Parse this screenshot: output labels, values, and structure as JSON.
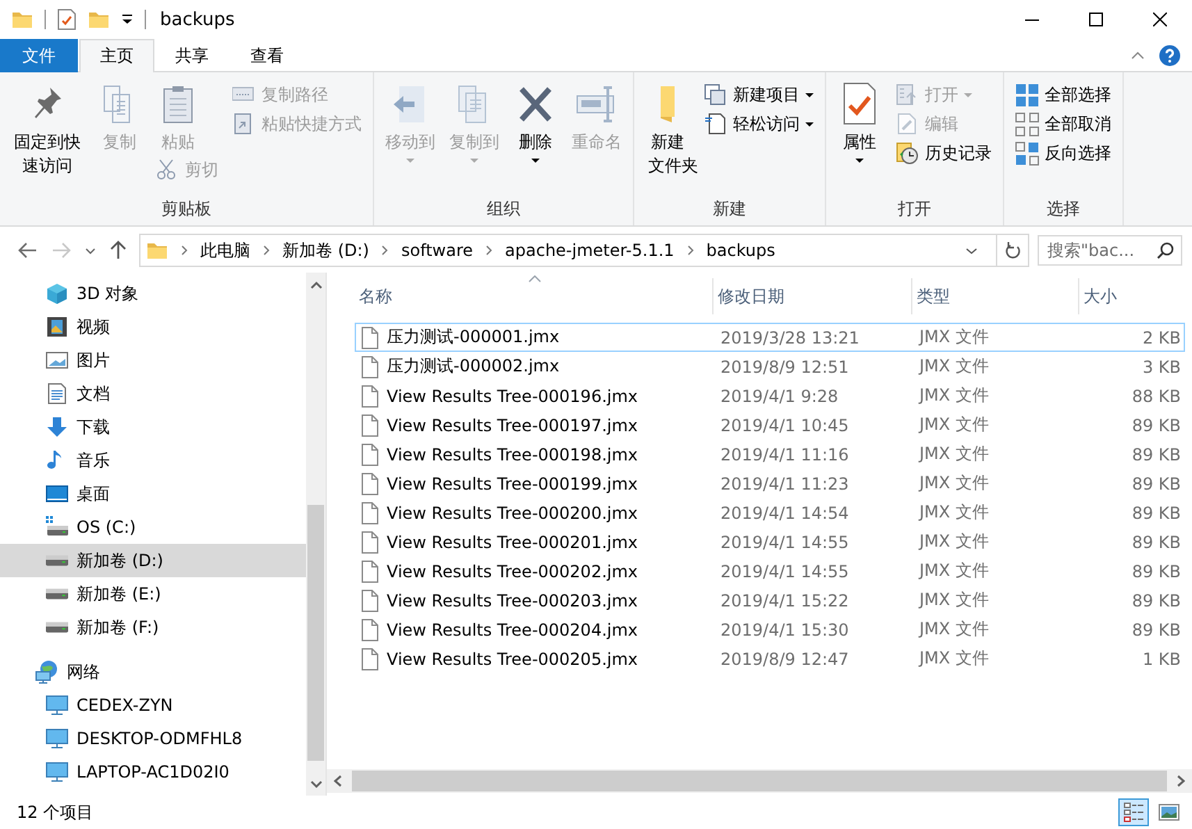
{
  "window": {
    "title": "backups"
  },
  "tabs": [
    {
      "label": "文件",
      "kind": "file",
      "selected": false
    },
    {
      "label": "主页",
      "kind": "normal",
      "selected": true
    },
    {
      "label": "共享",
      "kind": "normal",
      "selected": false
    },
    {
      "label": "查看",
      "kind": "normal",
      "selected": false
    }
  ],
  "ribbon": {
    "groups": [
      {
        "label": "剪贴板",
        "columns": [
          {
            "items": [
              {
                "label": "固定到快速访问",
                "kind": "large",
                "disabled": false,
                "dropdown": false
              }
            ]
          },
          {
            "items": [
              {
                "label": "复制",
                "kind": "large",
                "disabled": true,
                "dropdown": false
              }
            ]
          },
          {
            "items": [
              {
                "label": "粘贴",
                "kind": "large",
                "disabled": true,
                "dropdown": false
              },
              {
                "label": "剪切",
                "kind": "small",
                "disabled": true,
                "dropdown": false
              }
            ]
          },
          {
            "items": [
              {
                "label": "复制路径",
                "kind": "small",
                "disabled": true,
                "dropdown": false
              },
              {
                "label": "粘贴快捷方式",
                "kind": "small",
                "disabled": true,
                "dropdown": false
              }
            ]
          }
        ]
      },
      {
        "label": "组织",
        "columns": [
          {
            "items": [
              {
                "label": "移动到",
                "kind": "large",
                "disabled": true,
                "dropdown": true
              }
            ]
          },
          {
            "items": [
              {
                "label": "复制到",
                "kind": "large",
                "disabled": true,
                "dropdown": true
              }
            ]
          },
          {
            "items": [
              {
                "label": "删除",
                "kind": "large",
                "disabled": false,
                "dropdown": true
              }
            ]
          },
          {
            "items": [
              {
                "label": "重命名",
                "kind": "large",
                "disabled": true,
                "dropdown": false
              }
            ]
          }
        ]
      },
      {
        "label": "新建",
        "columns": [
          {
            "items": [
              {
                "label": "新建文件夹",
                "kind": "large",
                "disabled": false,
                "dropdown": false
              }
            ]
          },
          {
            "items": [
              {
                "label": "新建项目",
                "kind": "small",
                "disabled": false,
                "dropdown": true
              },
              {
                "label": "轻松访问",
                "kind": "small",
                "disabled": false,
                "dropdown": true
              }
            ]
          }
        ]
      },
      {
        "label": "打开",
        "columns": [
          {
            "items": [
              {
                "label": "属性",
                "kind": "large",
                "disabled": false,
                "dropdown": true
              }
            ]
          },
          {
            "items": [
              {
                "label": "打开",
                "kind": "small",
                "disabled": true,
                "dropdown": true
              },
              {
                "label": "编辑",
                "kind": "small",
                "disabled": true,
                "dropdown": false
              },
              {
                "label": "历史记录",
                "kind": "small",
                "disabled": false,
                "dropdown": false
              }
            ]
          }
        ]
      },
      {
        "label": "选择",
        "columns": [
          {
            "items": [
              {
                "label": "全部选择",
                "kind": "small",
                "disabled": false,
                "dropdown": false
              },
              {
                "label": "全部取消",
                "kind": "small",
                "disabled": false,
                "dropdown": false
              },
              {
                "label": "反向选择",
                "kind": "small",
                "disabled": false,
                "dropdown": false
              }
            ]
          }
        ]
      }
    ]
  },
  "address": {
    "back": {
      "disabled": false
    },
    "forward": {
      "disabled": true
    },
    "breadcrumbs": [
      "此电脑",
      "新加卷 (D:)",
      "software",
      "apache-jmeter-5.1.1",
      "backups"
    ],
    "search": {
      "placeholder": "搜索\"bac..."
    }
  },
  "nav": {
    "items": [
      {
        "label": "3D 对象",
        "selected": false
      },
      {
        "label": "视频",
        "selected": false
      },
      {
        "label": "图片",
        "selected": false
      },
      {
        "label": "文档",
        "selected": false
      },
      {
        "label": "下载",
        "selected": false
      },
      {
        "label": "音乐",
        "selected": false
      },
      {
        "label": "桌面",
        "selected": false
      },
      {
        "label": "OS (C:)",
        "selected": false
      },
      {
        "label": "新加卷 (D:)",
        "selected": true
      },
      {
        "label": "新加卷 (E:)",
        "selected": false
      },
      {
        "label": "新加卷 (F:)",
        "selected": false
      },
      {
        "label": "网络",
        "selected": false,
        "children": [
          {
            "label": "CEDEX-ZYN",
            "selected": false
          },
          {
            "label": "DESKTOP-ODMFHL8",
            "selected": false
          },
          {
            "label": "LAPTOP-AC1D02I0",
            "selected": false
          }
        ]
      }
    ]
  },
  "files": {
    "columns": [
      {
        "label": "名称",
        "sorted": true
      },
      {
        "label": "修改日期",
        "sorted": false
      },
      {
        "label": "类型",
        "sorted": false
      },
      {
        "label": "大小",
        "sorted": false
      }
    ],
    "rows": [
      {
        "name": "压力测试-000001.jmx",
        "modified": "2019/3/28 13:21",
        "type": "JMX 文件",
        "size": "2 KB",
        "focused": true
      },
      {
        "name": "压力测试-000002.jmx",
        "modified": "2019/8/9 12:51",
        "type": "JMX 文件",
        "size": "3 KB",
        "focused": false
      },
      {
        "name": "View Results Tree-000196.jmx",
        "modified": "2019/4/1 9:28",
        "type": "JMX 文件",
        "size": "88 KB",
        "focused": false
      },
      {
        "name": "View Results Tree-000197.jmx",
        "modified": "2019/4/1 10:45",
        "type": "JMX 文件",
        "size": "89 KB",
        "focused": false
      },
      {
        "name": "View Results Tree-000198.jmx",
        "modified": "2019/4/1 11:16",
        "type": "JMX 文件",
        "size": "89 KB",
        "focused": false
      },
      {
        "name": "View Results Tree-000199.jmx",
        "modified": "2019/4/1 11:23",
        "type": "JMX 文件",
        "size": "89 KB",
        "focused": false
      },
      {
        "name": "View Results Tree-000200.jmx",
        "modified": "2019/4/1 14:54",
        "type": "JMX 文件",
        "size": "89 KB",
        "focused": false
      },
      {
        "name": "View Results Tree-000201.jmx",
        "modified": "2019/4/1 14:55",
        "type": "JMX 文件",
        "size": "89 KB",
        "focused": false
      },
      {
        "name": "View Results Tree-000202.jmx",
        "modified": "2019/4/1 14:55",
        "type": "JMX 文件",
        "size": "89 KB",
        "focused": false
      },
      {
        "name": "View Results Tree-000203.jmx",
        "modified": "2019/4/1 15:22",
        "type": "JMX 文件",
        "size": "89 KB",
        "focused": false
      },
      {
        "name": "View Results Tree-000204.jmx",
        "modified": "2019/4/1 15:30",
        "type": "JMX 文件",
        "size": "89 KB",
        "focused": false
      },
      {
        "name": "View Results Tree-000205.jmx",
        "modified": "2019/8/9 12:47",
        "type": "JMX 文件",
        "size": "1 KB",
        "focused": false
      }
    ]
  },
  "status_bar": {
    "item_count": "12 个项目",
    "views": [
      {
        "selected": true
      },
      {
        "selected": false
      }
    ]
  }
}
